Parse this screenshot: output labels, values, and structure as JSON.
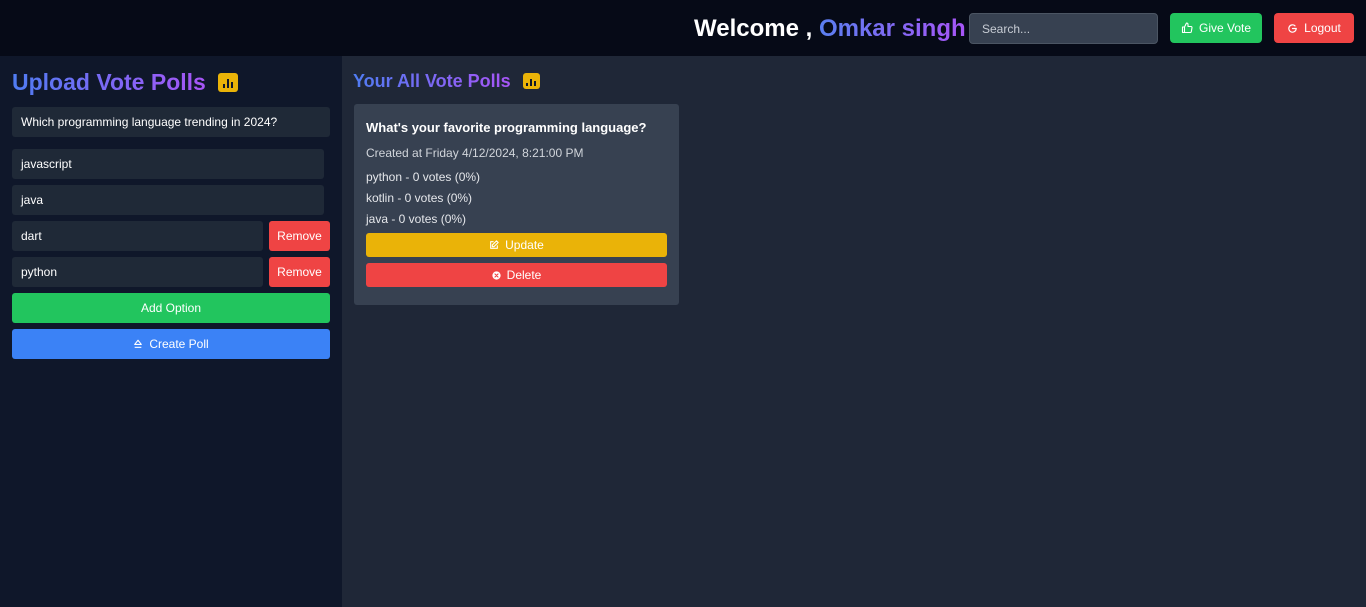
{
  "header": {
    "welcome_prefix": "Welcome ,",
    "user_name": "Omkar singh",
    "search_placeholder": "Search...",
    "give_vote_label": "Give Vote",
    "logout_label": "Logout"
  },
  "sidebar": {
    "title": "Upload Vote Polls",
    "question_value": "Which programming language trending in 2024?",
    "options": [
      {
        "value": "javascript",
        "removable": false
      },
      {
        "value": "java",
        "removable": false
      },
      {
        "value": "dart",
        "removable": true
      },
      {
        "value": "python",
        "removable": true
      }
    ],
    "remove_label": "Remove",
    "add_option_label": "Add Option",
    "create_poll_label": "Create Poll"
  },
  "main": {
    "title": "Your All Vote Polls",
    "polls": [
      {
        "question": "What's your favorite programming language?",
        "created": "Created at Friday 4/12/2024, 8:21:00 PM",
        "options": [
          "python - 0 votes (0%)",
          "kotlin - 0 votes (0%)",
          "java - 0 votes (0%)"
        ],
        "update_label": "Update",
        "delete_label": "Delete"
      }
    ]
  },
  "colors": {
    "header_bg": "#060a17",
    "sidebar_bg": "#0f172a",
    "main_bg": "#1f2737",
    "card_bg": "#374151",
    "green": "#22c55e",
    "red": "#ef4444",
    "blue": "#3b82f6",
    "yellow": "#eab308"
  }
}
